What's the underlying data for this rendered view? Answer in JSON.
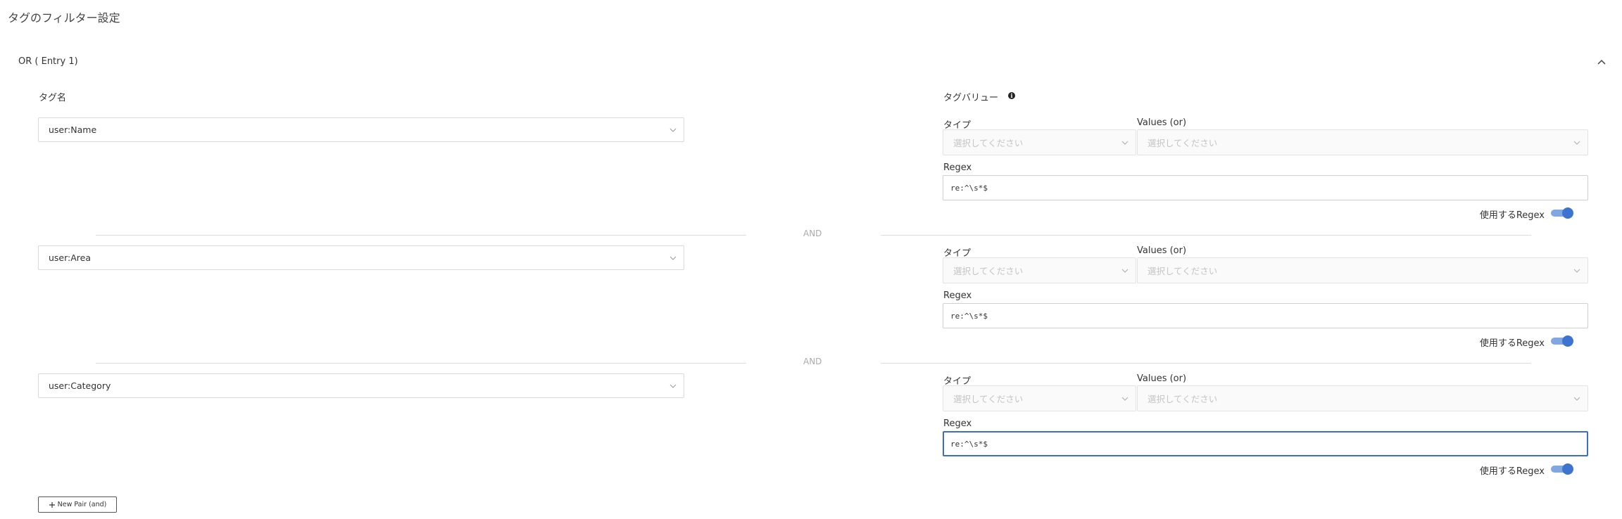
{
  "page_title": "タグのフィルター設定",
  "entry": {
    "header": "OR ( Entry 1)",
    "tag_name_label": "タグ名",
    "tag_value_label": "タグバリュー",
    "info_icon": "info-icon",
    "collapse_icon": "chevron-up-icon",
    "and_label": "AND",
    "rows": [
      {
        "tag_name": "user:Name",
        "type_label": "タイプ",
        "type_placeholder": "選択してください",
        "values_label": "Values (or)",
        "values_placeholder": "選択してください",
        "regex_label": "Regex",
        "regex_value": "re:^\\s*$",
        "toggle_label": "使用するRegex",
        "toggle_on": true
      },
      {
        "tag_name": "user:Area",
        "type_label": "タイプ",
        "type_placeholder": "選択してください",
        "values_label": "Values (or)",
        "values_placeholder": "選択してください",
        "regex_label": "Regex",
        "regex_value": "re:^\\s*$",
        "toggle_label": "使用するRegex",
        "toggle_on": true
      },
      {
        "tag_name": "user:Category",
        "type_label": "タイプ",
        "type_placeholder": "選択してください",
        "values_label": "Values (or)",
        "values_placeholder": "選択してください",
        "regex_label": "Regex",
        "regex_value": "re:^\\s*$",
        "toggle_label": "使用するRegex",
        "toggle_on": true
      }
    ]
  },
  "new_pair_button": {
    "label": "New Pair (and)",
    "icon": "plus-icon"
  },
  "colors": {
    "accent": "#3d74d0",
    "toggle_track": "#7fa8e3",
    "focus_border": "#3b6fc7"
  }
}
